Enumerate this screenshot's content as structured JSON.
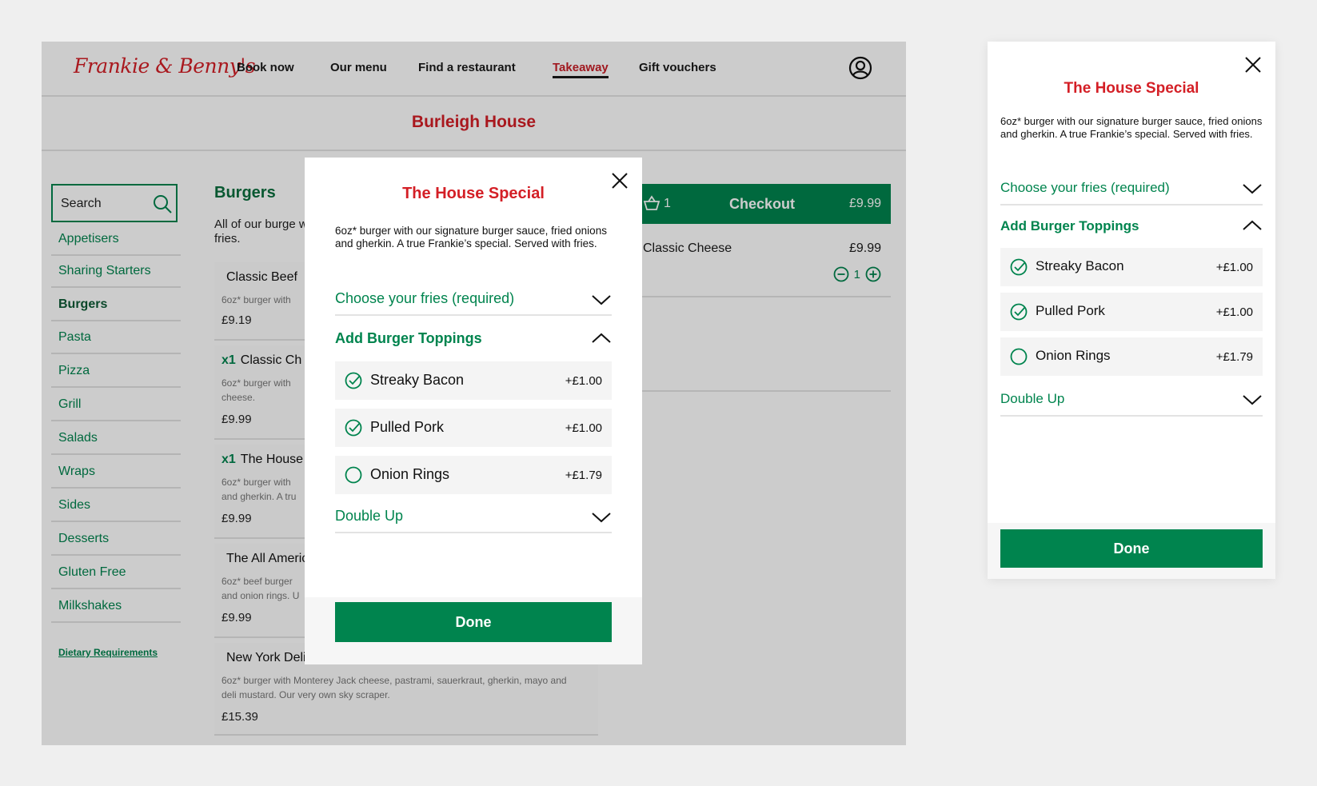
{
  "nav": {
    "logo": "Frankie & Benny's",
    "links": [
      "Book now",
      "Our menu",
      "Find a restaurant",
      "Takeaway",
      "Gift vouchers"
    ],
    "active": "Takeaway"
  },
  "restaurant": {
    "name": "Burleigh House"
  },
  "search": {
    "placeholder": "Search"
  },
  "categories": [
    "Appetisers",
    "Sharing Starters",
    "Burgers",
    "Pasta",
    "Pizza",
    "Grill",
    "Salads",
    "Wraps",
    "Sides",
    "Desserts",
    "Gluten Free",
    "Milkshakes"
  ],
  "current_category": "Burgers",
  "dietary_link": "Dietary Requirements",
  "section": {
    "title": "Burgers",
    "description": "All of our burge with fries."
  },
  "menu_items": [
    {
      "qty": "",
      "name": "Classic Beef",
      "desc": "6oz* burger with",
      "price": "£9.19"
    },
    {
      "qty": "x1",
      "name": "Classic Ch",
      "desc": "6oz* burger with cheese.",
      "price": "£9.99"
    },
    {
      "qty": "x1",
      "name": "The House",
      "desc": "6oz* burger with and gherkin. A tru",
      "price": "£9.99"
    },
    {
      "qty": "",
      "name": "The All Americ",
      "desc": "6oz* beef burger and onion rings. U",
      "price": "£9.99"
    },
    {
      "qty": "",
      "name": "New York Deli",
      "desc": "6oz* burger with Monterey Jack cheese, pastrami, sauerkraut, gherkin, mayo and deli mustard. Our very own sky scraper.",
      "price": "£15.39"
    }
  ],
  "basket": {
    "count": "1",
    "label": "Checkout",
    "total": "£9.99",
    "item_name": "Classic Cheese",
    "item_price": "£9.99",
    "item_qty": "1"
  },
  "modal": {
    "title": "The House Special",
    "description": "6oz* burger with our signature burger sauce, fried onions and gherkin. A true Frankie’s special. Served with fries.",
    "fries_label": "Choose your fries (required)",
    "toppings_label": "Add Burger Toppings",
    "options": [
      {
        "label": "Streaky Bacon",
        "price": "+£1.00",
        "selected": true
      },
      {
        "label": "Pulled Pork",
        "price": "+£1.00",
        "selected": true
      },
      {
        "label": "Onion Rings",
        "price": "+£1.79",
        "selected": false
      }
    ],
    "double_up_label": "Double Up",
    "done_label": "Done"
  },
  "colors": {
    "brand_red": "#d41f26",
    "brand_green": "#00844e",
    "overlay": "rgba(0,0,0,0.2)"
  },
  "icons": [
    "user-icon",
    "search-icon",
    "basket-icon",
    "close-icon",
    "chevron-down-icon",
    "chevron-up-icon",
    "check-circle-icon",
    "empty-circle-icon",
    "minus-circle-icon",
    "plus-circle-icon"
  ]
}
